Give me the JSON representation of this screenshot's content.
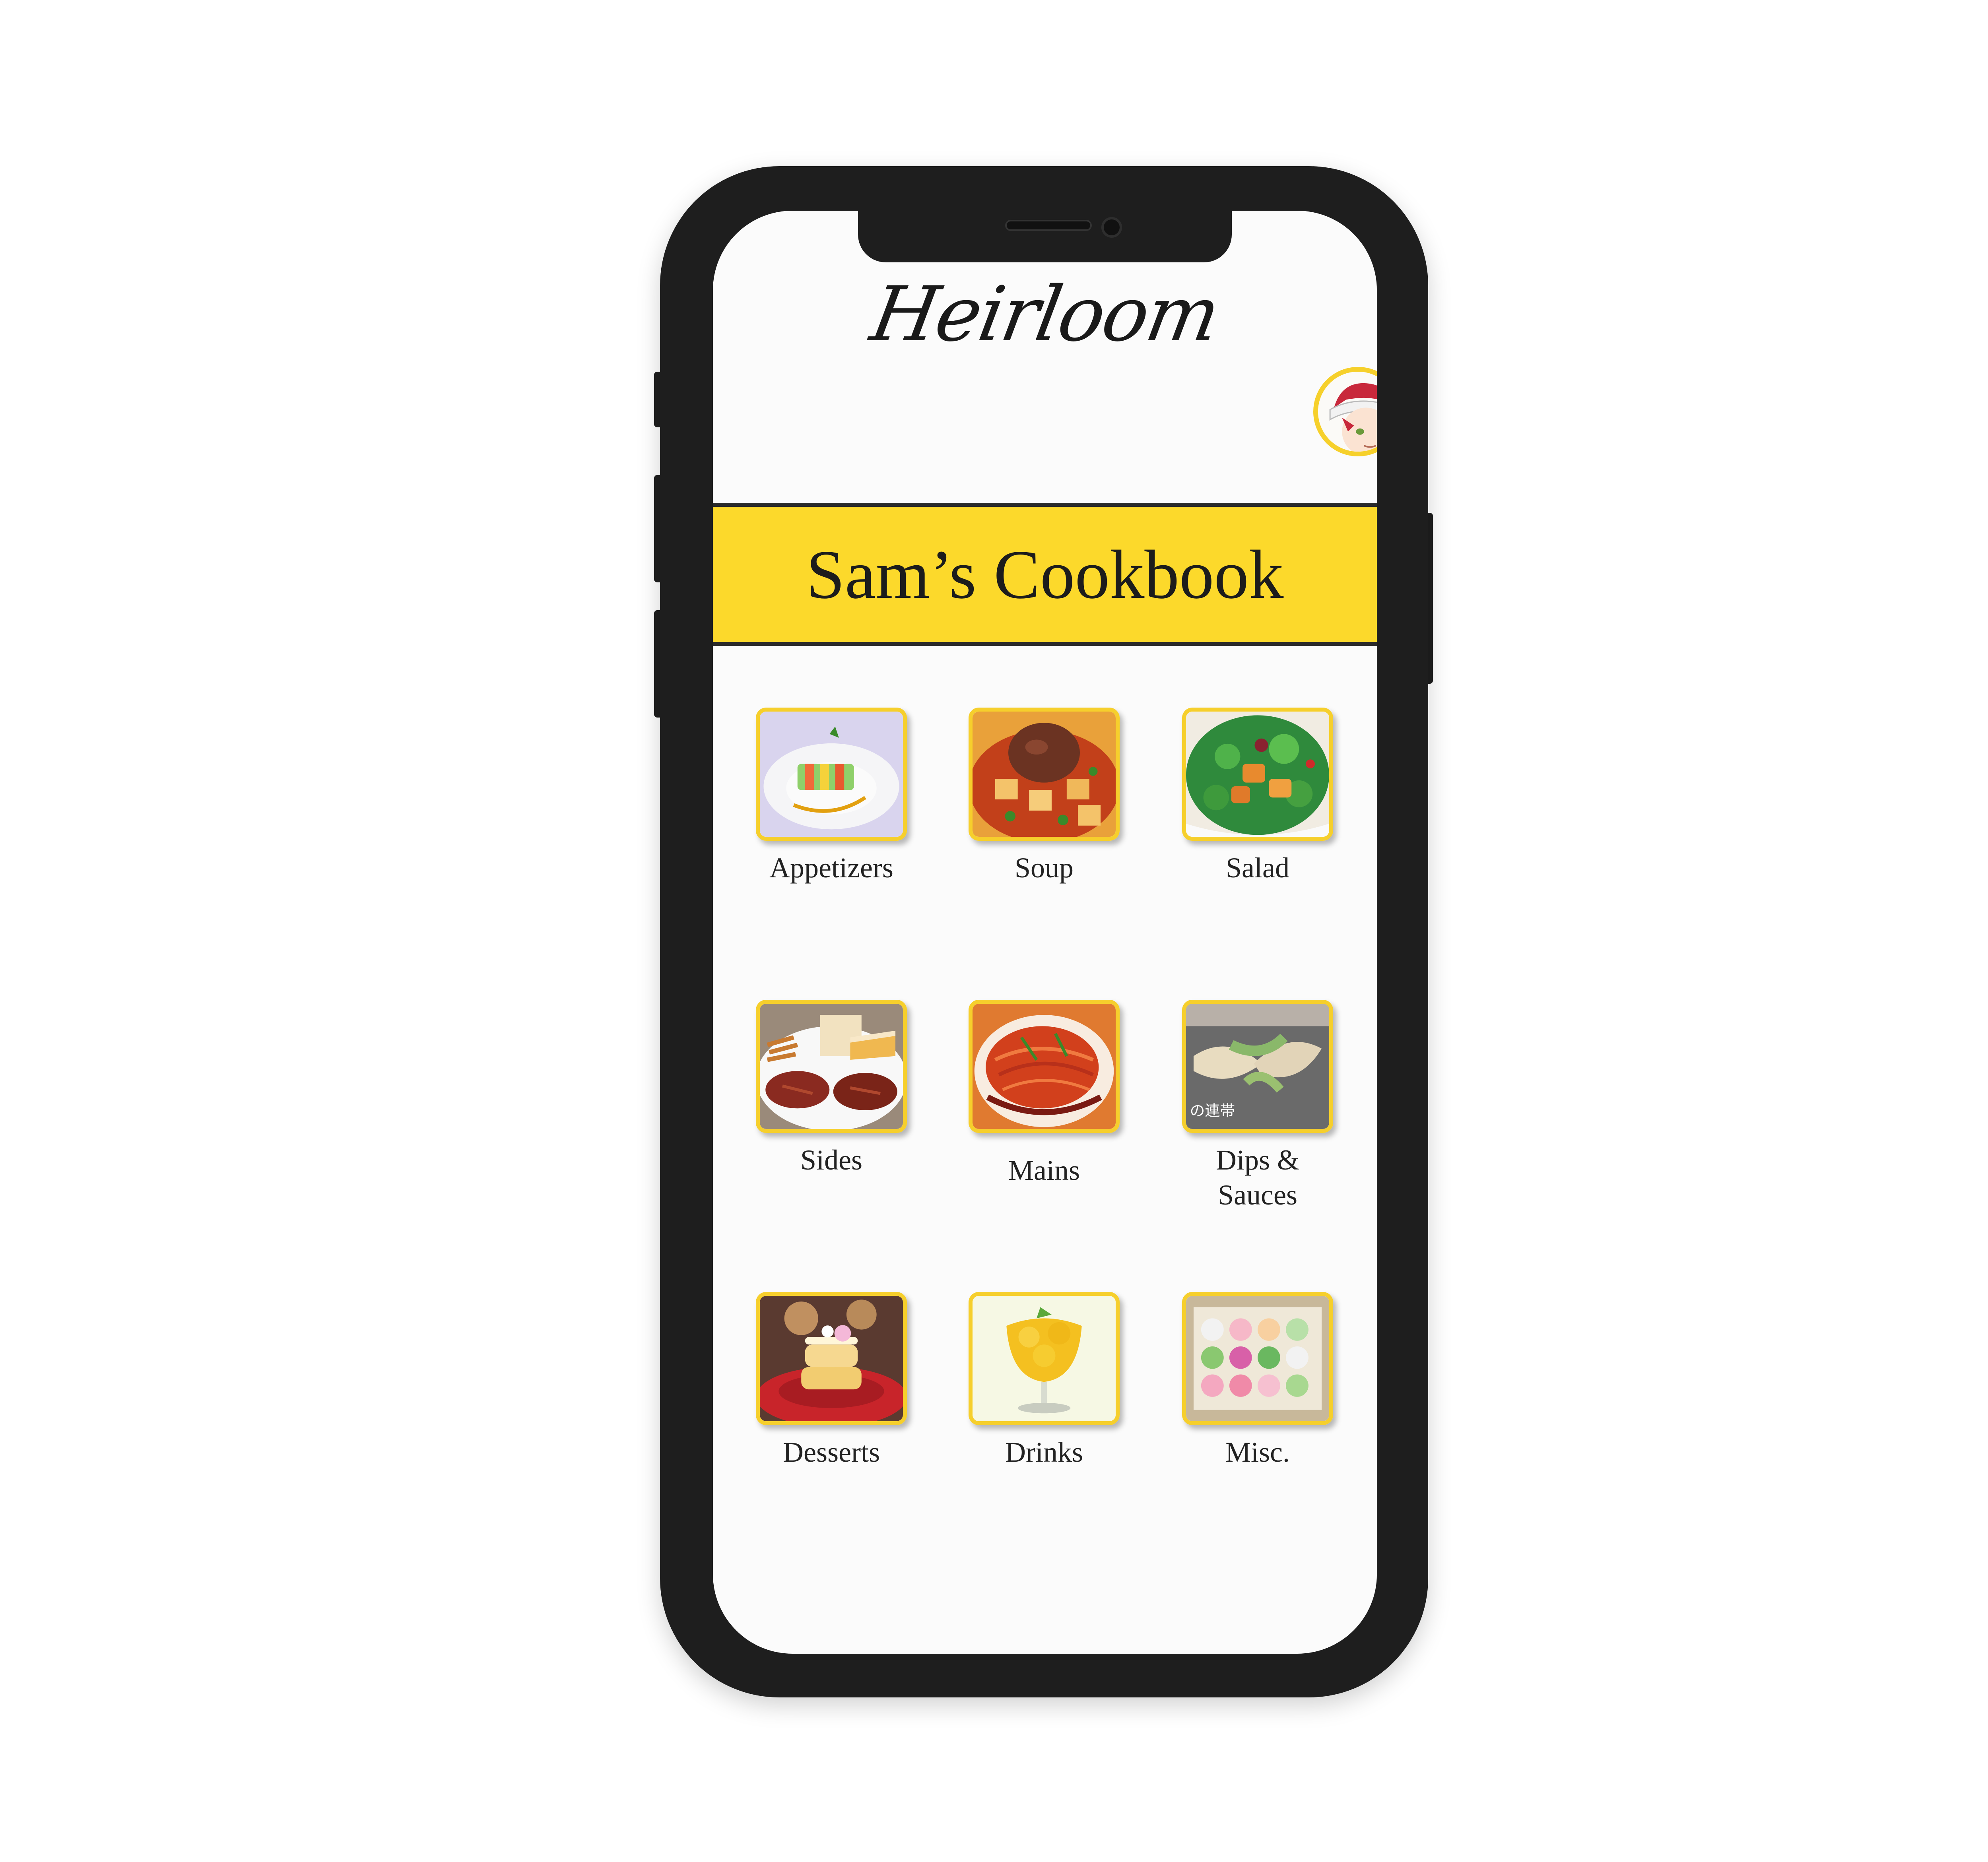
{
  "app": {
    "brand": "Heirloom",
    "cookbook_title": "Sam’s Cookbook"
  },
  "user": {
    "avatar_icon": "chef-avatar-icon"
  },
  "categories": [
    {
      "label": "Appetizers",
      "icon": "appetizers-image"
    },
    {
      "label": "Soup",
      "icon": "soup-image"
    },
    {
      "label": "Salad",
      "icon": "salad-image"
    },
    {
      "label": "Sides",
      "icon": "sides-image"
    },
    {
      "label": "Mains",
      "icon": "mains-image"
    },
    {
      "label": "Dips &\nSauces",
      "icon": "dips-sauces-image"
    },
    {
      "label": "Desserts",
      "icon": "desserts-image"
    },
    {
      "label": "Drinks",
      "icon": "drinks-image"
    },
    {
      "label": "Misc.",
      "icon": "misc-image"
    }
  ],
  "colors": {
    "accent_yellow": "#fcd92b",
    "tile_border": "#f6cf2c",
    "phone_frame": "#1e1e1e",
    "screen_bg": "#fbfbfb"
  }
}
